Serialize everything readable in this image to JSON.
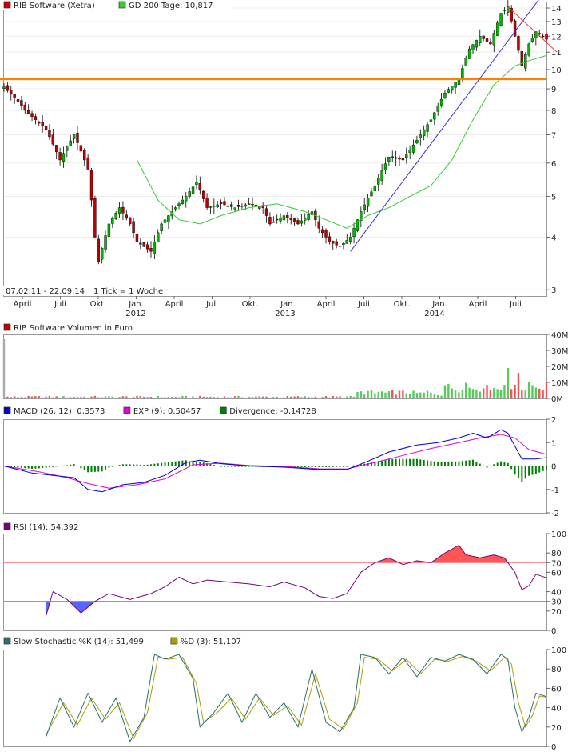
{
  "colors": {
    "up": "#00b800",
    "down": "#c00000",
    "gd": "#33cc33",
    "hline": "#ff8000",
    "trend_up": "#3333cc",
    "trend_down": "#e04040",
    "macd": "#0000cc",
    "exp": "#e000e0",
    "div": "#008000",
    "rsi": "#7a007a",
    "ovb": "#ff5555",
    "ovs": "#5566ff",
    "stochK": "#2a6f6f",
    "stochD": "#aaa000"
  },
  "price": {
    "legend": [
      {
        "label": "RIB Software (Xetra)",
        "swatch": "#c00000"
      },
      {
        "label": "GD 200 Tage: 10,817",
        "swatch": "#33cc33"
      }
    ],
    "info": "07.02.11 - 22.09.14",
    "info2": "1 Tick = 1 Woche",
    "yticks": [
      "14",
      "13",
      "12",
      "11",
      "10",
      "9",
      "8",
      "7",
      "6",
      "5",
      "4",
      "3"
    ],
    "xticks": [
      "April",
      "Juli",
      "Okt.",
      "Jan.",
      "April",
      "Juli",
      "Okt.",
      "Jan.",
      "April",
      "Juli",
      "Okt.",
      "Jan.",
      "April",
      "Juli"
    ],
    "years": [
      "2012",
      "2013",
      "2014"
    ]
  },
  "volume": {
    "legend": "RIB Software Volumen in Euro",
    "yticks": [
      "40M",
      "30M",
      "20M",
      "10M",
      "0M"
    ]
  },
  "macd": {
    "legend": [
      {
        "label": "MACD (26, 12): 0,3573",
        "swatch": "#0000cc"
      },
      {
        "label": "EXP (9): 0,50457",
        "swatch": "#e000e0"
      },
      {
        "label": "Divergence: -0,14728",
        "swatch": "#008000"
      }
    ],
    "yticks": [
      "2",
      "1",
      "0",
      "-1",
      "-2"
    ]
  },
  "rsi": {
    "legend": "RSI (14): 54,392",
    "yticks": [
      "100",
      "80",
      "70",
      "60",
      "40",
      "30",
      "20",
      "0"
    ]
  },
  "stoch": {
    "legend": [
      {
        "label": "Slow Stochastic %K (14): 51,499",
        "swatch": "#2a6f6f"
      },
      {
        "label": "%D (3): 51,107",
        "swatch": "#aaa000"
      }
    ],
    "yticks": [
      "100",
      "80",
      "60",
      "40",
      "20",
      "0"
    ]
  },
  "chart_data": [
    {
      "type": "candlestick",
      "title": "RIB Software (Xetra)",
      "period": "07.02.11 - 22.09.14",
      "interval": "1 Tick = 1 Woche",
      "scale": "log",
      "ylim": [
        2.9,
        14.5
      ],
      "close_path": [
        [
          0,
          9.1
        ],
        [
          6,
          8.0
        ],
        [
          12,
          7.2
        ],
        [
          16,
          6.1
        ],
        [
          20,
          7.0
        ],
        [
          24,
          5.8
        ],
        [
          26,
          4.0
        ],
        [
          27,
          3.5
        ],
        [
          30,
          4.3
        ],
        [
          33,
          4.7
        ],
        [
          36,
          4.3
        ],
        [
          38,
          3.9
        ],
        [
          42,
          3.7
        ],
        [
          45,
          4.3
        ],
        [
          48,
          4.6
        ],
        [
          52,
          5.0
        ],
        [
          55,
          5.4
        ],
        [
          58,
          4.7
        ],
        [
          62,
          4.8
        ],
        [
          66,
          4.7
        ],
        [
          70,
          4.8
        ],
        [
          74,
          4.7
        ],
        [
          76,
          4.3
        ],
        [
          80,
          4.5
        ],
        [
          84,
          4.3
        ],
        [
          88,
          4.6
        ],
        [
          90,
          4.2
        ],
        [
          93,
          3.9
        ],
        [
          96,
          3.8
        ],
        [
          99,
          4.0
        ],
        [
          102,
          4.6
        ],
        [
          106,
          5.3
        ],
        [
          110,
          6.2
        ],
        [
          114,
          6.1
        ],
        [
          118,
          6.8
        ],
        [
          122,
          7.6
        ],
        [
          126,
          8.8
        ],
        [
          130,
          9.5
        ],
        [
          133,
          11.2
        ],
        [
          136,
          12.0
        ],
        [
          139,
          11.5
        ],
        [
          142,
          13.6
        ],
        [
          144,
          14.1
        ],
        [
          146,
          12.0
        ],
        [
          148,
          10.2
        ],
        [
          150,
          11.5
        ],
        [
          152,
          12.3
        ],
        [
          155,
          11.8
        ]
      ],
      "gd200_path": [
        [
          38,
          6.1
        ],
        [
          44,
          4.9
        ],
        [
          50,
          4.4
        ],
        [
          56,
          4.3
        ],
        [
          62,
          4.5
        ],
        [
          70,
          4.7
        ],
        [
          78,
          4.8
        ],
        [
          86,
          4.6
        ],
        [
          92,
          4.4
        ],
        [
          98,
          4.2
        ],
        [
          104,
          4.5
        ],
        [
          110,
          4.7
        ],
        [
          116,
          5.0
        ],
        [
          122,
          5.3
        ],
        [
          128,
          6.1
        ],
        [
          134,
          7.6
        ],
        [
          140,
          9.2
        ],
        [
          146,
          10.2
        ],
        [
          150,
          10.5
        ],
        [
          155,
          10.8
        ]
      ],
      "horizontal_line": 9.5,
      "trend_up": [
        [
          99,
          3.7
        ],
        [
          155,
          15.5
        ]
      ],
      "trend_down": [
        [
          144,
          14.1
        ],
        [
          158,
          11.0
        ]
      ]
    },
    {
      "type": "bar",
      "title": "RIB Software Volumen in Euro",
      "ylim": [
        0,
        40
      ],
      "unit": "M EUR",
      "highlights": [
        {
          "week": 0,
          "value": 37
        },
        {
          "week": 144,
          "value": 19
        },
        {
          "week": 147,
          "value": 16
        },
        {
          "week": 150,
          "value": 10
        }
      ]
    },
    {
      "type": "line",
      "title": "MACD (26, 12)",
      "ylim": [
        -2,
        2
      ],
      "series": [
        {
          "name": "MACD (26, 12)",
          "points": [
            [
              0,
              0
            ],
            [
              8,
              -0.3
            ],
            [
              14,
              -0.4
            ],
            [
              20,
              -0.5
            ],
            [
              24,
              -1.0
            ],
            [
              28,
              -1.1
            ],
            [
              34,
              -0.8
            ],
            [
              40,
              -0.7
            ],
            [
              46,
              -0.4
            ],
            [
              52,
              0.15
            ],
            [
              56,
              0.25
            ],
            [
              62,
              0.1
            ],
            [
              70,
              0.0
            ],
            [
              80,
              -0.05
            ],
            [
              90,
              -0.15
            ],
            [
              98,
              -0.15
            ],
            [
              104,
              0.2
            ],
            [
              110,
              0.6
            ],
            [
              118,
              0.9
            ],
            [
              124,
              1.0
            ],
            [
              130,
              1.2
            ],
            [
              134,
              1.4
            ],
            [
              138,
              1.2
            ],
            [
              142,
              1.55
            ],
            [
              144,
              1.4
            ],
            [
              148,
              0.3
            ],
            [
              152,
              0.3
            ],
            [
              155,
              0.36
            ]
          ]
        },
        {
          "name": "EXP (9)",
          "points": [
            [
              0,
              0
            ],
            [
              10,
              -0.25
            ],
            [
              18,
              -0.5
            ],
            [
              24,
              -0.75
            ],
            [
              30,
              -0.95
            ],
            [
              38,
              -0.8
            ],
            [
              46,
              -0.55
            ],
            [
              54,
              0.05
            ],
            [
              62,
              0.12
            ],
            [
              70,
              0.02
            ],
            [
              80,
              -0.02
            ],
            [
              90,
              -0.12
            ],
            [
              98,
              -0.13
            ],
            [
              106,
              0.15
            ],
            [
              114,
              0.45
            ],
            [
              122,
              0.75
            ],
            [
              130,
              1.0
            ],
            [
              136,
              1.2
            ],
            [
              142,
              1.35
            ],
            [
              146,
              1.2
            ],
            [
              150,
              0.7
            ],
            [
              155,
              0.5
            ]
          ]
        }
      ],
      "divergence_last": -0.14728
    },
    {
      "type": "line",
      "title": "RSI (14)",
      "ylim": [
        0,
        100
      ],
      "levels": [
        30,
        70
      ],
      "points": [
        [
          12,
          15
        ],
        [
          14,
          40
        ],
        [
          18,
          32
        ],
        [
          22,
          18
        ],
        [
          26,
          30
        ],
        [
          30,
          38
        ],
        [
          36,
          32
        ],
        [
          42,
          38
        ],
        [
          46,
          45
        ],
        [
          50,
          55
        ],
        [
          54,
          48
        ],
        [
          58,
          52
        ],
        [
          64,
          50
        ],
        [
          70,
          48
        ],
        [
          76,
          45
        ],
        [
          80,
          50
        ],
        [
          86,
          44
        ],
        [
          90,
          35
        ],
        [
          94,
          33
        ],
        [
          98,
          38
        ],
        [
          102,
          60
        ],
        [
          106,
          70
        ],
        [
          110,
          75
        ],
        [
          114,
          68
        ],
        [
          118,
          72
        ],
        [
          122,
          70
        ],
        [
          126,
          80
        ],
        [
          130,
          88
        ],
        [
          132,
          78
        ],
        [
          136,
          75
        ],
        [
          140,
          78
        ],
        [
          143,
          75
        ],
        [
          146,
          60
        ],
        [
          148,
          42
        ],
        [
          150,
          46
        ],
        [
          152,
          58
        ],
        [
          155,
          54.4
        ]
      ]
    },
    {
      "type": "line",
      "title": "Slow Stochastic",
      "ylim": [
        0,
        100
      ],
      "series": [
        {
          "name": "Slow Stochastic %K (14)",
          "points": [
            [
              12,
              10
            ],
            [
              16,
              50
            ],
            [
              20,
              20
            ],
            [
              24,
              55
            ],
            [
              28,
              25
            ],
            [
              32,
              50
            ],
            [
              36,
              5
            ],
            [
              40,
              30
            ],
            [
              43,
              95
            ],
            [
              46,
              90
            ],
            [
              50,
              95
            ],
            [
              54,
              70
            ],
            [
              56,
              20
            ],
            [
              60,
              35
            ],
            [
              64,
              55
            ],
            [
              68,
              25
            ],
            [
              72,
              55
            ],
            [
              76,
              30
            ],
            [
              80,
              45
            ],
            [
              84,
              20
            ],
            [
              88,
              80
            ],
            [
              92,
              25
            ],
            [
              96,
              15
            ],
            [
              100,
              40
            ],
            [
              102,
              95
            ],
            [
              106,
              92
            ],
            [
              110,
              75
            ],
            [
              114,
              92
            ],
            [
              118,
              72
            ],
            [
              122,
              92
            ],
            [
              126,
              88
            ],
            [
              130,
              95
            ],
            [
              134,
              90
            ],
            [
              138,
              75
            ],
            [
              142,
              95
            ],
            [
              144,
              90
            ],
            [
              146,
              40
            ],
            [
              148,
              15
            ],
            [
              150,
              30
            ],
            [
              152,
              55
            ],
            [
              155,
              51.5
            ]
          ]
        },
        {
          "name": "%D (3)",
          "points": [
            [
              12,
              12
            ],
            [
              17,
              45
            ],
            [
              21,
              22
            ],
            [
              25,
              50
            ],
            [
              29,
              28
            ],
            [
              33,
              45
            ],
            [
              37,
              8
            ],
            [
              41,
              35
            ],
            [
              44,
              92
            ],
            [
              47,
              90
            ],
            [
              51,
              92
            ],
            [
              55,
              65
            ],
            [
              57,
              25
            ],
            [
              61,
              35
            ],
            [
              65,
              50
            ],
            [
              69,
              28
            ],
            [
              73,
              50
            ],
            [
              77,
              32
            ],
            [
              81,
              42
            ],
            [
              85,
              22
            ],
            [
              89,
              75
            ],
            [
              93,
              28
            ],
            [
              97,
              18
            ],
            [
              101,
              45
            ],
            [
              103,
              92
            ],
            [
              107,
              90
            ],
            [
              111,
              78
            ],
            [
              115,
              90
            ],
            [
              119,
              75
            ],
            [
              123,
              90
            ],
            [
              127,
              88
            ],
            [
              131,
              93
            ],
            [
              135,
              88
            ],
            [
              139,
              78
            ],
            [
              143,
              92
            ],
            [
              145,
              85
            ],
            [
              147,
              45
            ],
            [
              149,
              20
            ],
            [
              151,
              32
            ],
            [
              153,
              52
            ],
            [
              155,
              51.1
            ]
          ]
        }
      ]
    }
  ]
}
